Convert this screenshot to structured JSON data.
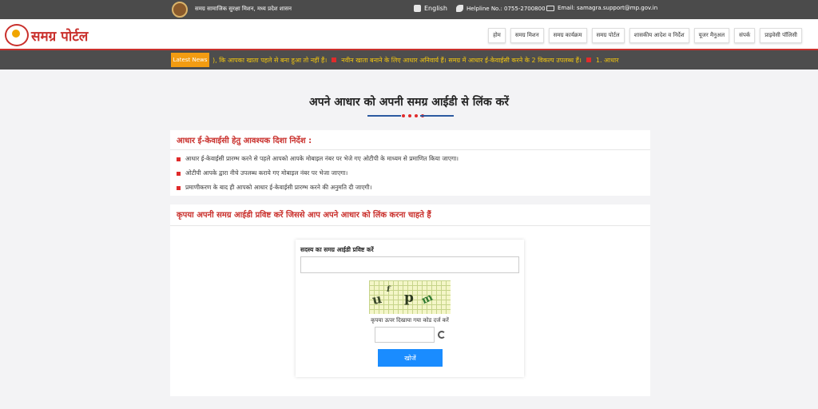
{
  "topbar": {
    "department": "समग्र सामाजिक सुरक्षा मिशन, मध्य प्रदेश शासन",
    "language": "English",
    "helpline": "Helpline No.: 0755-2700800",
    "email": "Email: samagra.support@mp.gov.in",
    "icons": [
      "emblem-icon",
      "language-icon",
      "phone-icon",
      "mail-icon"
    ]
  },
  "header": {
    "logo_text": "समग्र पोर्टल",
    "nav": [
      "होम",
      "समग्र मिशन",
      "समग्र कार्यक्रम",
      "समग्र पोर्टल",
      "शासकीय आदेश व निर्देश",
      "यूजर मैनुअल",
      "संपर्क",
      "प्राइवेसी पॉलिसी"
    ]
  },
  "ticker": {
    "label": "Latest News",
    "items": [
      "), कि आपका खाता पहले से बना हुआ तो नहीं हैं।",
      "नवीन खाता बनाने के लिए आधार अनिवार्य हैं। समग्र में आधार ई-केवाईसी करने के 2 विकल्प उपलब्ध हैं।",
      "1. आधार"
    ]
  },
  "page": {
    "title": "अपने आधार को अपनी समग्र आईडी से लिंक करें"
  },
  "guidelines": {
    "heading": "आधार ई-केवाईसी हेतु आवश्यक दिशा निर्देश :",
    "items": [
      "आधार ई-केवाईसी प्रारम्भ करने से पहले आपको आपके मोबाइल नंबर पर भेजे गए ओटीपी के माध्यम से प्रमाणित किया जाएगा।",
      "ओटीपी आपके द्वारा नीचे उपलब्ध कराये गए मोबाइल नंबर पर भेजा जाएगा।",
      "प्रमाणीकरण के बाद ही आपको आधार ई-केवाईसी प्रारम्भ करने की अनुमति दी जाएगी।"
    ]
  },
  "form": {
    "heading": "कृपया अपनी समग्र आईडी प्रविष्ट करें जिससे आप अपने आधार को लिंक करना चाहते हैं",
    "samagra_label": "सदस्य का समग्र आईडी प्रविष्ट करें",
    "samagra_value": "",
    "captcha_chars": [
      "u",
      "f",
      "p",
      "m"
    ],
    "captcha_help": "कृपया ऊपर दिखाया गया कोड दर्ज करें",
    "captcha_value": "",
    "search_button": "खोजें"
  },
  "colors": {
    "accent": "#c9302c",
    "ticker_text": "#f1c40f",
    "latest_news_bg": "#f39c12",
    "button": "#1a8cff"
  }
}
